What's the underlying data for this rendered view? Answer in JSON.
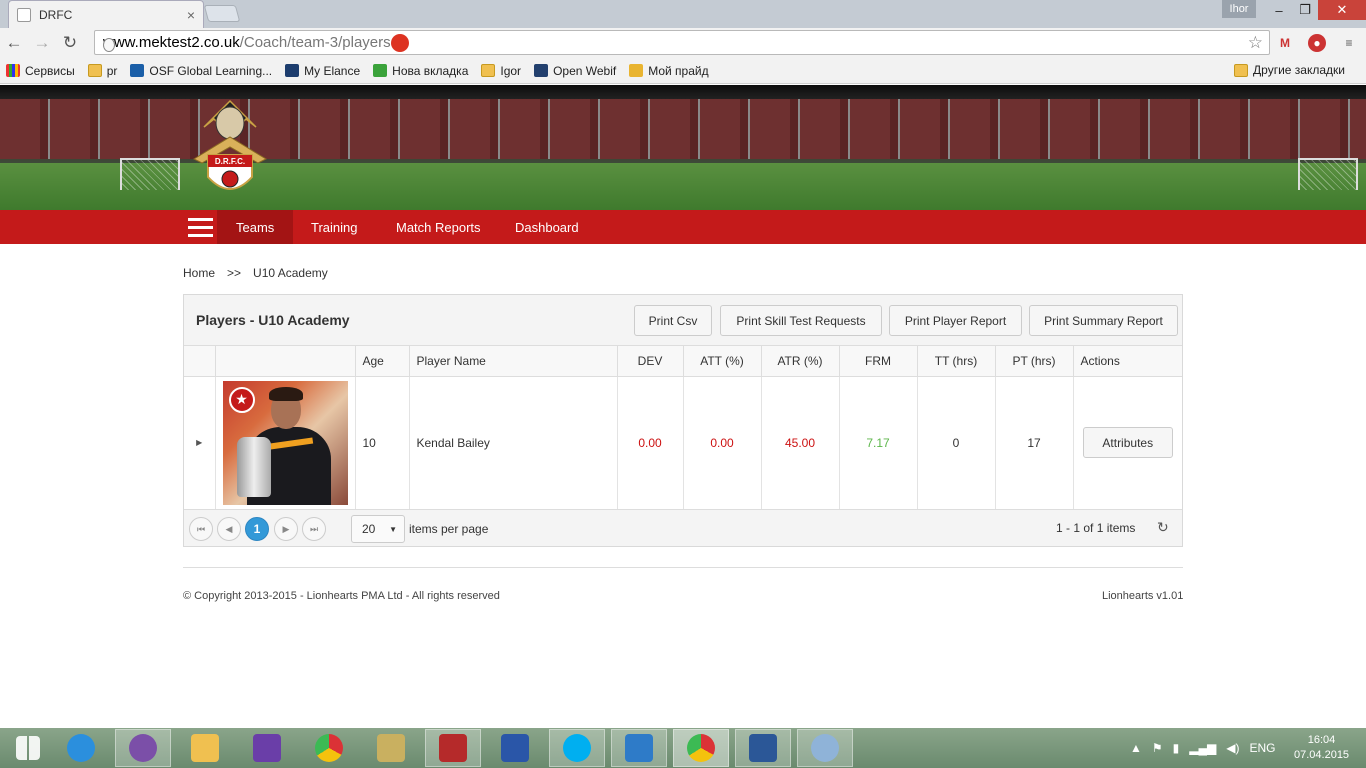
{
  "browser": {
    "tab_title": "DRFC",
    "user_label": "Ihor",
    "url_domain": "www.mektest2.co.uk",
    "url_path": "/Coach/team-3/players",
    "bookmarks": [
      "Сервисы",
      "pr",
      "OSF Global Learning...",
      "My Elance",
      "Нова вкладка",
      "Igor",
      "Open Webif",
      "Мой прайд"
    ],
    "other_bookmarks": "Другие закладки"
  },
  "site": {
    "logo_text": "D.R.F.C.",
    "nav": {
      "teams": "Teams",
      "training": "Training",
      "match_reports": "Match Reports",
      "dashboard": "Dashboard"
    },
    "breadcrumb": {
      "home": "Home",
      "sep": ">>",
      "current": "U10 Academy"
    }
  },
  "panel": {
    "title": "Players - U10 Academy",
    "buttons": {
      "csv": "Print Csv",
      "skill": "Print Skill Test Requests",
      "player": "Print Player Report",
      "summary": "Print Summary Report"
    },
    "columns": [
      "",
      "",
      "Age",
      "Player Name",
      "DEV",
      "ATT (%)",
      "ATR (%)",
      "FRM",
      "TT (hrs)",
      "PT (hrs)",
      "Actions"
    ],
    "rows": [
      {
        "age": "10",
        "name": "Kendal Bailey",
        "dev": "0.00",
        "att": "0.00",
        "atr": "45.00",
        "frm": "7.17",
        "tt": "0",
        "pt": "17",
        "action": "Attributes"
      }
    ],
    "pager": {
      "current_page": "1",
      "page_size": "20",
      "items_per_page": "items per page",
      "info": "1 - 1 of 1 items"
    }
  },
  "footer": {
    "copyright": "© Copyright 2013-2015 - Lionhearts PMA Ltd - All rights reserved",
    "version": "Lionhearts v1.01"
  },
  "taskbar": {
    "lang": "ENG",
    "time": "16:04",
    "date": "07.04.2015"
  }
}
